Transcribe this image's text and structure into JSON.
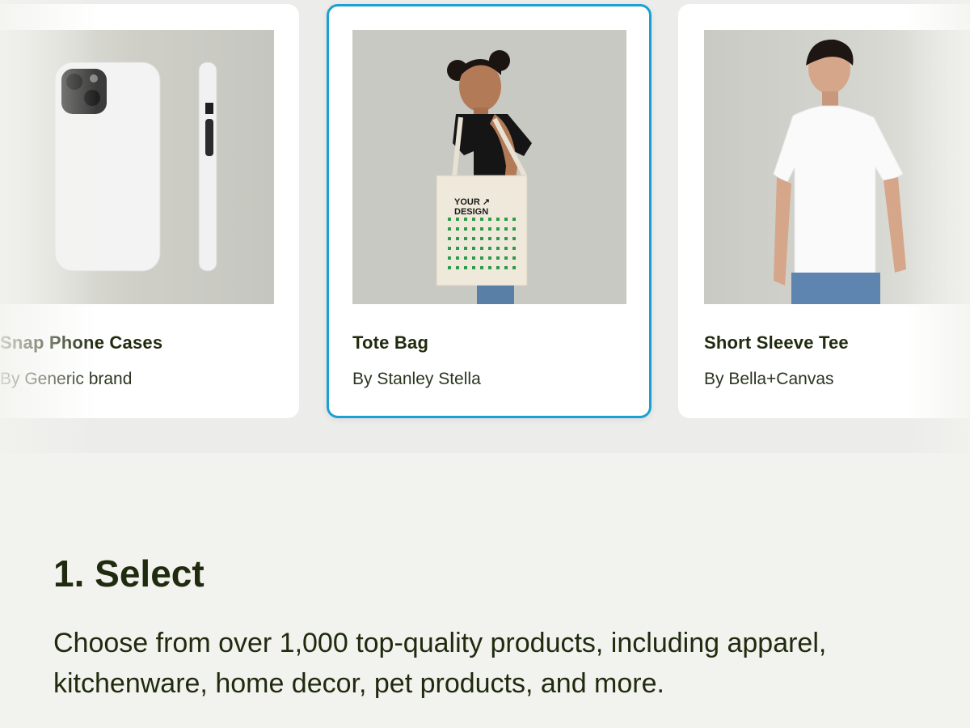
{
  "products": [
    {
      "title": "Snap Phone Cases",
      "brand": "By Generic brand",
      "icon": "phone-case-image"
    },
    {
      "title": "Tote Bag",
      "brand": "By Stanley Stella",
      "icon": "tote-bag-image",
      "design_text": "YOUR ↗\nDESIGN"
    },
    {
      "title": "Short Sleeve Tee",
      "brand": "By Bella+Canvas",
      "icon": "tee-image"
    }
  ],
  "step": {
    "title": "1. Select",
    "description": "Choose from over 1,000 top-quality products, including apparel, kitchenware, home decor, pet products, and more."
  },
  "colors": {
    "selected_border": "#1aa0d2",
    "text_dark": "#1f2a0e",
    "background": "#f2f2ee"
  }
}
